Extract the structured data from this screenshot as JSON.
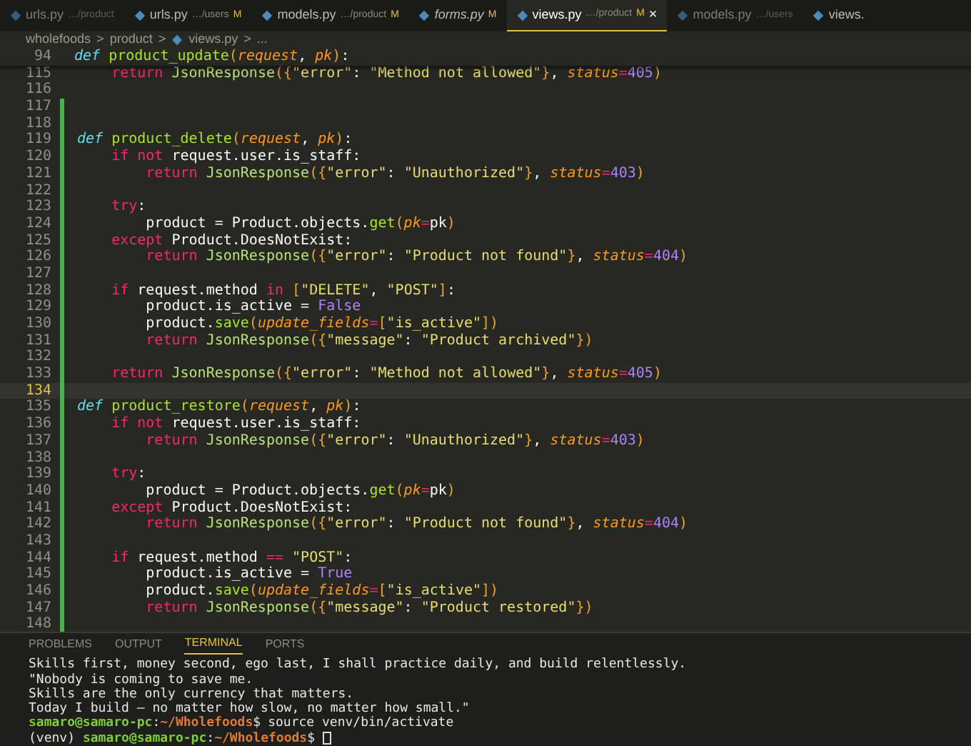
{
  "tabs": [
    {
      "name": "urls.py",
      "path": "…/product",
      "preview": false,
      "selected": false,
      "dim": true
    },
    {
      "name": "urls.py",
      "path": "…/users",
      "badge": "M",
      "preview": false,
      "selected": false,
      "dim": false
    },
    {
      "name": "models.py",
      "path": "…/product",
      "badge": "M",
      "preview": false,
      "selected": false,
      "dim": false
    },
    {
      "name": "forms.py",
      "badge": "M",
      "preview": true,
      "selected": false,
      "dim": false
    },
    {
      "name": "views.py",
      "path": "…/product",
      "badge": "M",
      "preview": false,
      "selected": true,
      "dim": false,
      "close": "×"
    },
    {
      "name": "models.py",
      "path": "…/users",
      "preview": false,
      "selected": false,
      "dim": true
    },
    {
      "name": "views.",
      "preview": false,
      "selected": false,
      "dim": false
    }
  ],
  "breadcrumb": [
    {
      "text": "wholefoods"
    },
    {
      "separator": ">",
      "text": "product"
    },
    {
      "separator": ">",
      "text": "views.py",
      "kind": "file"
    },
    {
      "separator": ">",
      "text": "..."
    }
  ],
  "sticky_line": {
    "number": "94",
    "tokens": [
      {
        "kind": "def",
        "text": "def "
      },
      {
        "kind": "fn",
        "text": "product_update"
      },
      {
        "kind": "br",
        "text": "("
      },
      {
        "kind": "param",
        "text": "request"
      },
      {
        "kind": "p",
        "text": ", "
      },
      {
        "kind": "param",
        "text": "pk"
      },
      {
        "kind": "br",
        "text": ")"
      },
      {
        "kind": "p",
        "text": ":"
      }
    ]
  },
  "lines": [
    {
      "number": "115",
      "active": false,
      "modified": false,
      "tokens": [
        {
          "kind": "kw",
          "text": "    return "
        },
        {
          "kind": "cls",
          "text": "JsonResponse"
        },
        {
          "kind": "br",
          "text": "({"
        },
        {
          "kind": "str",
          "text": "\"error\""
        },
        {
          "kind": "p",
          "text": ": "
        },
        {
          "kind": "str",
          "text": "\"Method not allowed\""
        },
        {
          "kind": "br",
          "text": "}"
        },
        {
          "kind": "p",
          "text": ", "
        },
        {
          "kind": "param",
          "text": "status"
        },
        {
          "kind": "kw",
          "text": "="
        },
        {
          "kind": "num",
          "text": "405"
        },
        {
          "kind": "br",
          "text": ")"
        }
      ]
    },
    {
      "number": "116",
      "active": false,
      "modified": false
    },
    {
      "number": "117",
      "active": false,
      "modified": true
    },
    {
      "number": "118",
      "active": false,
      "modified": true
    },
    {
      "number": "119",
      "active": false,
      "modified": true,
      "tokens": [
        {
          "kind": "def",
          "text": "def "
        },
        {
          "kind": "fn",
          "text": "product_delete"
        },
        {
          "kind": "br",
          "text": "("
        },
        {
          "kind": "param",
          "text": "request"
        },
        {
          "kind": "p",
          "text": ", "
        },
        {
          "kind": "param",
          "text": "pk"
        },
        {
          "kind": "br",
          "text": ")"
        },
        {
          "kind": "p",
          "text": ":"
        }
      ]
    },
    {
      "number": "120",
      "active": false,
      "modified": true,
      "tokens": [
        {
          "kind": "kw",
          "text": "    if not "
        },
        {
          "kind": "p",
          "text": "request.user.is_staff:"
        }
      ]
    },
    {
      "number": "121",
      "active": false,
      "modified": true,
      "tokens": [
        {
          "kind": "kw",
          "text": "        return "
        },
        {
          "kind": "cls",
          "text": "JsonResponse"
        },
        {
          "kind": "br",
          "text": "({"
        },
        {
          "kind": "str",
          "text": "\"error\""
        },
        {
          "kind": "p",
          "text": ": "
        },
        {
          "kind": "str",
          "text": "\"Unauthorized\""
        },
        {
          "kind": "br",
          "text": "}"
        },
        {
          "kind": "p",
          "text": ", "
        },
        {
          "kind": "param",
          "text": "status"
        },
        {
          "kind": "kw",
          "text": "="
        },
        {
          "kind": "num",
          "text": "403"
        },
        {
          "kind": "br",
          "text": ")"
        }
      ]
    },
    {
      "number": "122",
      "active": false,
      "modified": true
    },
    {
      "number": "123",
      "active": false,
      "modified": true,
      "tokens": [
        {
          "kind": "kw",
          "text": "    try"
        },
        {
          "kind": "p",
          "text": ":"
        }
      ]
    },
    {
      "number": "124",
      "active": false,
      "modified": true,
      "tokens": [
        {
          "kind": "p",
          "text": "        product = Product.objects."
        },
        {
          "kind": "fn",
          "text": "get"
        },
        {
          "kind": "br",
          "text": "("
        },
        {
          "kind": "param",
          "text": "pk"
        },
        {
          "kind": "kw",
          "text": "="
        },
        {
          "kind": "p",
          "text": "pk"
        },
        {
          "kind": "br",
          "text": ")"
        }
      ]
    },
    {
      "number": "125",
      "active": false,
      "modified": true,
      "tokens": [
        {
          "kind": "kw",
          "text": "    except "
        },
        {
          "kind": "p",
          "text": "Product.DoesNotExist:"
        }
      ]
    },
    {
      "number": "126",
      "active": false,
      "modified": true,
      "tokens": [
        {
          "kind": "kw",
          "text": "        return "
        },
        {
          "kind": "cls",
          "text": "JsonResponse"
        },
        {
          "kind": "br",
          "text": "({"
        },
        {
          "kind": "str",
          "text": "\"error\""
        },
        {
          "kind": "p",
          "text": ": "
        },
        {
          "kind": "str",
          "text": "\"Product not found\""
        },
        {
          "kind": "br",
          "text": "}"
        },
        {
          "kind": "p",
          "text": ", "
        },
        {
          "kind": "param",
          "text": "status"
        },
        {
          "kind": "kw",
          "text": "="
        },
        {
          "kind": "num",
          "text": "404"
        },
        {
          "kind": "br",
          "text": ")"
        }
      ]
    },
    {
      "number": "127",
      "active": false,
      "modified": true
    },
    {
      "number": "128",
      "active": false,
      "modified": true,
      "tokens": [
        {
          "kind": "kw",
          "text": "    if "
        },
        {
          "kind": "p",
          "text": "request.method "
        },
        {
          "kind": "kw",
          "text": "in "
        },
        {
          "kind": "br",
          "text": "["
        },
        {
          "kind": "str",
          "text": "\"DELETE\""
        },
        {
          "kind": "p",
          "text": ", "
        },
        {
          "kind": "str",
          "text": "\"POST\""
        },
        {
          "kind": "br",
          "text": "]"
        },
        {
          "kind": "p",
          "text": ":"
        }
      ]
    },
    {
      "number": "129",
      "active": false,
      "modified": true,
      "tokens": [
        {
          "kind": "p",
          "text": "        product.is_active = "
        },
        {
          "kind": "num",
          "text": "False"
        }
      ]
    },
    {
      "number": "130",
      "active": false,
      "modified": true,
      "tokens": [
        {
          "kind": "p",
          "text": "        product."
        },
        {
          "kind": "fn",
          "text": "save"
        },
        {
          "kind": "br",
          "text": "("
        },
        {
          "kind": "param",
          "text": "update_fields"
        },
        {
          "kind": "kw",
          "text": "="
        },
        {
          "kind": "br",
          "text": "["
        },
        {
          "kind": "str",
          "text": "\"is_active\""
        },
        {
          "kind": "br",
          "text": "])"
        }
      ]
    },
    {
      "number": "131",
      "active": false,
      "modified": true,
      "tokens": [
        {
          "kind": "kw",
          "text": "        return "
        },
        {
          "kind": "cls",
          "text": "JsonResponse"
        },
        {
          "kind": "br",
          "text": "({"
        },
        {
          "kind": "str",
          "text": "\"message\""
        },
        {
          "kind": "p",
          "text": ": "
        },
        {
          "kind": "str",
          "text": "\"Product archived\""
        },
        {
          "kind": "br",
          "text": "})"
        }
      ]
    },
    {
      "number": "132",
      "active": false,
      "modified": true
    },
    {
      "number": "133",
      "active": false,
      "modified": true,
      "tokens": [
        {
          "kind": "kw",
          "text": "    return "
        },
        {
          "kind": "cls",
          "text": "JsonResponse"
        },
        {
          "kind": "br",
          "text": "({"
        },
        {
          "kind": "str",
          "text": "\"error\""
        },
        {
          "kind": "p",
          "text": ": "
        },
        {
          "kind": "str",
          "text": "\"Method not allowed\""
        },
        {
          "kind": "br",
          "text": "}"
        },
        {
          "kind": "p",
          "text": ", "
        },
        {
          "kind": "param",
          "text": "status"
        },
        {
          "kind": "kw",
          "text": "="
        },
        {
          "kind": "num",
          "text": "405"
        },
        {
          "kind": "br",
          "text": ")"
        }
      ]
    },
    {
      "number": "134",
      "active": true,
      "modified": true
    },
    {
      "number": "135",
      "active": false,
      "modified": true,
      "tokens": [
        {
          "kind": "def",
          "text": "def "
        },
        {
          "kind": "fn",
          "text": "product_restore"
        },
        {
          "kind": "br",
          "text": "("
        },
        {
          "kind": "param",
          "text": "request"
        },
        {
          "kind": "p",
          "text": ", "
        },
        {
          "kind": "param",
          "text": "pk"
        },
        {
          "kind": "br",
          "text": ")"
        },
        {
          "kind": "p",
          "text": ":"
        }
      ]
    },
    {
      "number": "136",
      "active": false,
      "modified": true,
      "tokens": [
        {
          "kind": "kw",
          "text": "    if not "
        },
        {
          "kind": "p",
          "text": "request.user.is_staff:"
        }
      ]
    },
    {
      "number": "137",
      "active": false,
      "modified": true,
      "tokens": [
        {
          "kind": "kw",
          "text": "        return "
        },
        {
          "kind": "cls",
          "text": "JsonResponse"
        },
        {
          "kind": "br",
          "text": "({"
        },
        {
          "kind": "str",
          "text": "\"error\""
        },
        {
          "kind": "p",
          "text": ": "
        },
        {
          "kind": "str",
          "text": "\"Unauthorized\""
        },
        {
          "kind": "br",
          "text": "}"
        },
        {
          "kind": "p",
          "text": ", "
        },
        {
          "kind": "param",
          "text": "status"
        },
        {
          "kind": "kw",
          "text": "="
        },
        {
          "kind": "num",
          "text": "403"
        },
        {
          "kind": "br",
          "text": ")"
        }
      ]
    },
    {
      "number": "138",
      "active": false,
      "modified": true
    },
    {
      "number": "139",
      "active": false,
      "modified": true,
      "tokens": [
        {
          "kind": "kw",
          "text": "    try"
        },
        {
          "kind": "p",
          "text": ":"
        }
      ]
    },
    {
      "number": "140",
      "active": false,
      "modified": true,
      "tokens": [
        {
          "kind": "p",
          "text": "        product = Product.objects."
        },
        {
          "kind": "fn",
          "text": "get"
        },
        {
          "kind": "br",
          "text": "("
        },
        {
          "kind": "param",
          "text": "pk"
        },
        {
          "kind": "kw",
          "text": "="
        },
        {
          "kind": "p",
          "text": "pk"
        },
        {
          "kind": "br",
          "text": ")"
        }
      ]
    },
    {
      "number": "141",
      "active": false,
      "modified": true,
      "tokens": [
        {
          "kind": "kw",
          "text": "    except "
        },
        {
          "kind": "p",
          "text": "Product.DoesNotExist:"
        }
      ]
    },
    {
      "number": "142",
      "active": false,
      "modified": true,
      "tokens": [
        {
          "kind": "kw",
          "text": "        return "
        },
        {
          "kind": "cls",
          "text": "JsonResponse"
        },
        {
          "kind": "br",
          "text": "({"
        },
        {
          "kind": "str",
          "text": "\"error\""
        },
        {
          "kind": "p",
          "text": ": "
        },
        {
          "kind": "str",
          "text": "\"Product not found\""
        },
        {
          "kind": "br",
          "text": "}"
        },
        {
          "kind": "p",
          "text": ", "
        },
        {
          "kind": "param",
          "text": "status"
        },
        {
          "kind": "kw",
          "text": "="
        },
        {
          "kind": "num",
          "text": "404"
        },
        {
          "kind": "br",
          "text": ")"
        }
      ]
    },
    {
      "number": "143",
      "active": false,
      "modified": true
    },
    {
      "number": "144",
      "active": false,
      "modified": true,
      "tokens": [
        {
          "kind": "kw",
          "text": "    if "
        },
        {
          "kind": "p",
          "text": "request.method "
        },
        {
          "kind": "kw",
          "text": "== "
        },
        {
          "kind": "str",
          "text": "\"POST\""
        },
        {
          "kind": "p",
          "text": ":"
        }
      ]
    },
    {
      "number": "145",
      "active": false,
      "modified": true,
      "tokens": [
        {
          "kind": "p",
          "text": "        product.is_active = "
        },
        {
          "kind": "num",
          "text": "True"
        }
      ]
    },
    {
      "number": "146",
      "active": false,
      "modified": true,
      "tokens": [
        {
          "kind": "p",
          "text": "        product."
        },
        {
          "kind": "fn",
          "text": "save"
        },
        {
          "kind": "br",
          "text": "("
        },
        {
          "kind": "param",
          "text": "update_fields"
        },
        {
          "kind": "kw",
          "text": "="
        },
        {
          "kind": "br",
          "text": "["
        },
        {
          "kind": "str",
          "text": "\"is_active\""
        },
        {
          "kind": "br",
          "text": "])"
        }
      ]
    },
    {
      "number": "147",
      "active": false,
      "modified": true,
      "tokens": [
        {
          "kind": "kw",
          "text": "        return "
        },
        {
          "kind": "cls",
          "text": "JsonResponse"
        },
        {
          "kind": "br",
          "text": "({"
        },
        {
          "kind": "str",
          "text": "\"message\""
        },
        {
          "kind": "p",
          "text": ": "
        },
        {
          "kind": "str",
          "text": "\"Product restored\""
        },
        {
          "kind": "br",
          "text": "})"
        }
      ]
    },
    {
      "number": "148",
      "active": false,
      "modified": true
    }
  ],
  "panel_tabs": [
    {
      "label": "PROBLEMS",
      "selected": false
    },
    {
      "label": "OUTPUT",
      "selected": false
    },
    {
      "label": "TERMINAL",
      "selected": true
    },
    {
      "label": "PORTS",
      "selected": false
    }
  ],
  "terminal": [
    {
      "kind": "output",
      "text": "Skills first, money second, ego last, I shall practice daily, and build relentlessly."
    },
    {
      "kind": "output",
      "text": "\"Nobody is coming to save me."
    },
    {
      "kind": "output",
      "text": "Skills are the only currency that matters."
    },
    {
      "kind": "output",
      "text": "Today I build — no matter how slow, no matter how small.\""
    },
    {
      "kind": "prompt",
      "user": "samaro@samaro-pc",
      "colon": ":",
      "path": "~/Wholefoods",
      "dollar": "$",
      "command": "source venv/bin/activate",
      "cursor": false
    },
    {
      "kind": "prompt",
      "prefix": "(venv)",
      "user": "samaro@samaro-pc",
      "colon": ":",
      "path": "~/Wholefoods",
      "dollar": "$",
      "cursor": true
    }
  ]
}
